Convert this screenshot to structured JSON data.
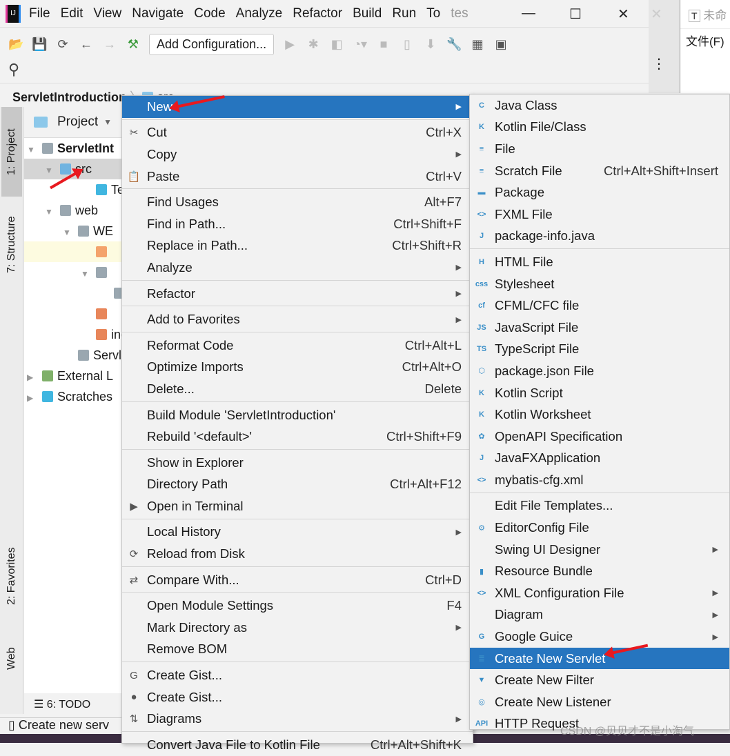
{
  "titlebar": {
    "menus": [
      "File",
      "Edit",
      "View",
      "Navigate",
      "Code",
      "Analyze",
      "Refactor",
      "Build",
      "Run",
      "To"
    ],
    "title_fragment": "tes"
  },
  "toolbar": {
    "config_label": "Add Configuration..."
  },
  "breadcrumb": {
    "project": "ServletIntroduction",
    "folder": "src"
  },
  "side_tabs": {
    "project": "1: Project",
    "structure": "7: Structure",
    "favorites": "2: Favorites",
    "web": "Web"
  },
  "project_panel": {
    "title": "Project",
    "tree": [
      "ServletInt",
      "src",
      "Tes",
      "web",
      "WE",
      "",
      "",
      "",
      "",
      "ind",
      "Servlet",
      "External L",
      "Scratches"
    ]
  },
  "bottom": {
    "todo": "6: TODO",
    "status": "Create new serv"
  },
  "right_window": {
    "tab": "未命",
    "menu": "文件(F)"
  },
  "watermark": "CSDN @贝贝才不是小淘气",
  "context_menu": [
    [
      {
        "label": "New",
        "arrow": true,
        "selected": true
      }
    ],
    [
      {
        "label": "Cut",
        "shortcut": "Ctrl+X",
        "icon": "✂"
      },
      {
        "label": "Copy",
        "arrow": true
      },
      {
        "label": "Paste",
        "shortcut": "Ctrl+V",
        "icon": "📋"
      }
    ],
    [
      {
        "label": "Find Usages",
        "shortcut": "Alt+F7"
      },
      {
        "label": "Find in Path...",
        "shortcut": "Ctrl+Shift+F"
      },
      {
        "label": "Replace in Path...",
        "shortcut": "Ctrl+Shift+R"
      },
      {
        "label": "Analyze",
        "arrow": true
      }
    ],
    [
      {
        "label": "Refactor",
        "arrow": true
      }
    ],
    [
      {
        "label": "Add to Favorites",
        "arrow": true
      }
    ],
    [
      {
        "label": "Reformat Code",
        "shortcut": "Ctrl+Alt+L"
      },
      {
        "label": "Optimize Imports",
        "shortcut": "Ctrl+Alt+O"
      },
      {
        "label": "Delete...",
        "shortcut": "Delete"
      }
    ],
    [
      {
        "label": "Build Module 'ServletIntroduction'"
      },
      {
        "label": "Rebuild '<default>'",
        "shortcut": "Ctrl+Shift+F9"
      }
    ],
    [
      {
        "label": "Show in Explorer"
      },
      {
        "label": "Directory Path",
        "shortcut": "Ctrl+Alt+F12"
      },
      {
        "label": "Open in Terminal",
        "icon": "▶"
      }
    ],
    [
      {
        "label": "Local History",
        "arrow": true
      },
      {
        "label": "Reload from Disk",
        "icon": "⟳"
      }
    ],
    [
      {
        "label": "Compare With...",
        "shortcut": "Ctrl+D",
        "icon": "⇄"
      }
    ],
    [
      {
        "label": "Open Module Settings",
        "shortcut": "F4"
      },
      {
        "label": "Mark Directory as",
        "arrow": true
      },
      {
        "label": "Remove BOM"
      }
    ],
    [
      {
        "label": "Create Gist...",
        "icon": "G"
      },
      {
        "label": "Create Gist...",
        "icon": "●"
      },
      {
        "label": "Diagrams",
        "arrow": true,
        "icon": "⇅"
      }
    ],
    [
      {
        "label": "Convert Java File to Kotlin File",
        "shortcut": "Ctrl+Alt+Shift+K"
      }
    ]
  ],
  "new_submenu": [
    [
      {
        "label": "Java Class",
        "icon": "C"
      },
      {
        "label": "Kotlin File/Class",
        "icon": "K"
      },
      {
        "label": "File",
        "icon": "≡"
      },
      {
        "label": "Scratch File",
        "shortcut": "Ctrl+Alt+Shift+Insert",
        "icon": "≡"
      },
      {
        "label": "Package",
        "icon": "▬"
      },
      {
        "label": "FXML File",
        "icon": "<>"
      },
      {
        "label": "package-info.java",
        "icon": "J"
      }
    ],
    [
      {
        "label": "HTML File",
        "icon": "H"
      },
      {
        "label": "Stylesheet",
        "icon": "css"
      },
      {
        "label": "CFML/CFC file",
        "icon": "cf"
      },
      {
        "label": "JavaScript File",
        "icon": "JS"
      },
      {
        "label": "TypeScript File",
        "icon": "TS"
      },
      {
        "label": "package.json File",
        "icon": "⬡"
      },
      {
        "label": "Kotlin Script",
        "icon": "K"
      },
      {
        "label": "Kotlin Worksheet",
        "icon": "K"
      },
      {
        "label": "OpenAPI Specification",
        "icon": "✿"
      },
      {
        "label": "JavaFXApplication",
        "icon": "J"
      },
      {
        "label": "mybatis-cfg.xml",
        "icon": "<>"
      }
    ],
    [
      {
        "label": "Edit File Templates..."
      },
      {
        "label": "EditorConfig File",
        "icon": "⚙"
      },
      {
        "label": "Swing UI Designer",
        "arrow": true
      },
      {
        "label": "Resource Bundle",
        "icon": "▮"
      },
      {
        "label": "XML Configuration File",
        "arrow": true,
        "icon": "<>"
      },
      {
        "label": "Diagram",
        "arrow": true
      },
      {
        "label": "Google Guice",
        "arrow": true,
        "icon": "G"
      },
      {
        "label": "Create New Servlet",
        "selected": true,
        "icon": "≣"
      },
      {
        "label": "Create New Filter",
        "icon": "▼"
      },
      {
        "label": "Create New Listener",
        "icon": "◎"
      },
      {
        "label": "HTTP Request",
        "icon": "API"
      }
    ]
  ],
  "colors": {
    "selection": "#2675bf",
    "arrow": "#e8191f"
  }
}
